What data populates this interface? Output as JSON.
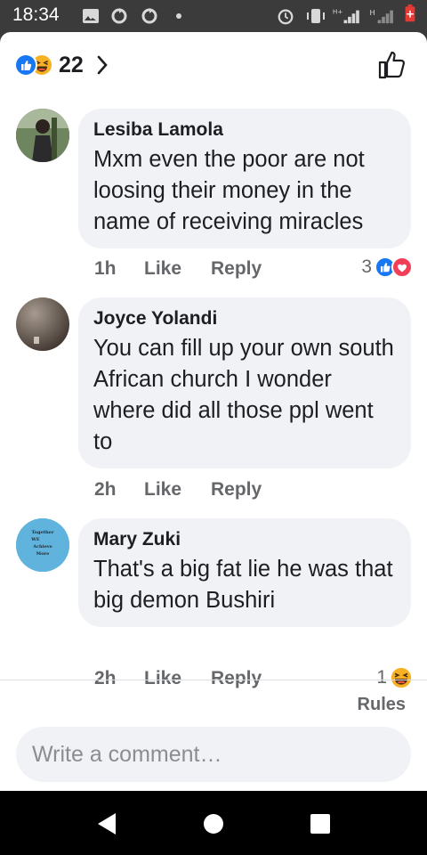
{
  "status_bar": {
    "time": "18:34",
    "icons": [
      "gallery-icon",
      "sync-icon",
      "sync-icon",
      "dot-icon",
      "alarm-icon",
      "vibrate-icon",
      "signal-icon",
      "signal-icon",
      "battery-low-icon"
    ]
  },
  "reactions": {
    "count": "22",
    "types": [
      "like",
      "haha"
    ]
  },
  "comments": [
    {
      "author": "Lesiba Lamola",
      "text": "Mxm even the poor are not loosing their money in the name of receiving miracles",
      "time": "1h",
      "like_label": "Like",
      "reply_label": "Reply",
      "reaction_count": "3",
      "reaction_types": [
        "like",
        "love"
      ]
    },
    {
      "author": "Joyce Yolandi",
      "text": "You can fill up your own south African church I wonder where did all those ppl went to",
      "time": "2h",
      "like_label": "Like",
      "reply_label": "Reply"
    },
    {
      "author": "Mary Zuki",
      "text": "That's a big fat lie he was that big demon Bushiri",
      "time": "2h",
      "like_label": "Like",
      "reply_label": "Reply",
      "reaction_count": "1",
      "reaction_types": [
        "haha"
      ],
      "avatar_text": "Together We Achieve More"
    }
  ],
  "footer": {
    "rules_label": "Rules",
    "comment_placeholder": "Write a comment…"
  },
  "colors": {
    "like_blue": "#1877f2",
    "love_red": "#f33e58",
    "haha_yellow": "#f7b125",
    "secondary_text": "#65676b",
    "bubble_bg": "#f0f2f5"
  }
}
